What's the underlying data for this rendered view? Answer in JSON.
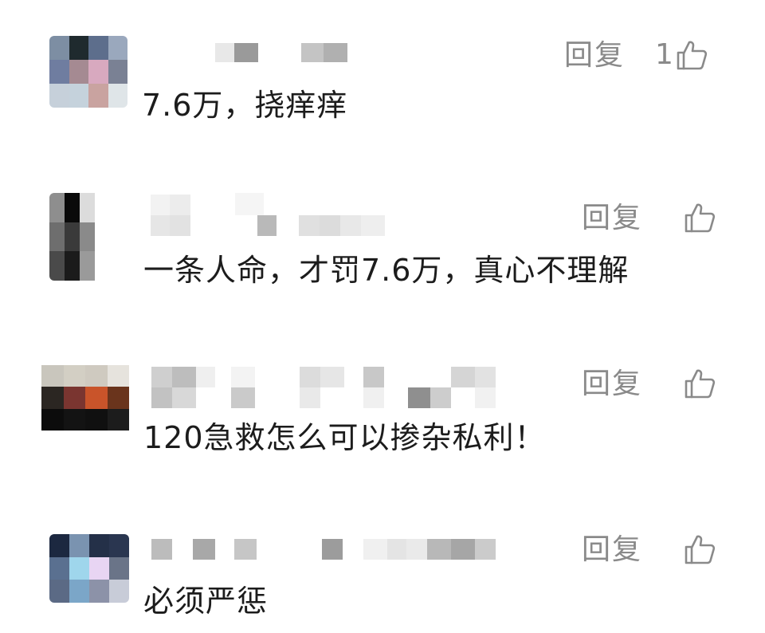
{
  "comments": [
    {
      "reply_label": "回复",
      "like_count": "1",
      "text": "7.6万，挠痒痒",
      "avatar_colors": [
        "#7d8ea3",
        "#1f2a2e",
        "#5d6e8c",
        "#9aa8bd",
        "#6f7da0",
        "#a58a92",
        "#d8a9bf",
        "#7a8194",
        "#c6d0da",
        "#c5d2dc",
        "#c9a3a0",
        "#dfe5e8"
      ]
    },
    {
      "reply_label": "回复",
      "like_count": "",
      "text": "一条人命，才罚7.6万，真心不理解",
      "avatar_colors": [
        "#8e8e8e",
        "#0a0a0a",
        "#dcdcdc",
        "#ffffff",
        "#6e6e6e",
        "#3a3a3a",
        "#8a8a8a",
        "#ffffff",
        "#4a4a4a",
        "#1b1b1b",
        "#9a9a9a",
        "#ffffff"
      ]
    },
    {
      "reply_label": "回复",
      "like_count": "",
      "text": "120急救怎么可以掺杂私利！",
      "avatar_colors": [
        "#c9c6bd",
        "#d3cfc4",
        "#cfcac0",
        "#e6e3dd",
        "#2b2622",
        "#7a3530",
        "#c9542a",
        "#6a341c",
        "#0c0c0c",
        "#131313",
        "#101010",
        "#1c1c1c"
      ]
    },
    {
      "reply_label": "回复",
      "like_count": "",
      "text": "必须严惩",
      "avatar_colors": [
        "#1c2840",
        "#7a93b0",
        "#243048",
        "#2a3650",
        "#5a7090",
        "#9fd6ec",
        "#e8d5f3",
        "#6a7488",
        "#5b6a85",
        "#7ba6c8",
        "#8c92a8",
        "#c8ccd8"
      ]
    }
  ],
  "colors": {
    "text": "#1c1c1c",
    "muted": "#8a8a8a",
    "background": "#ffffff"
  },
  "icons": {
    "like": "thumbs-up-icon"
  }
}
